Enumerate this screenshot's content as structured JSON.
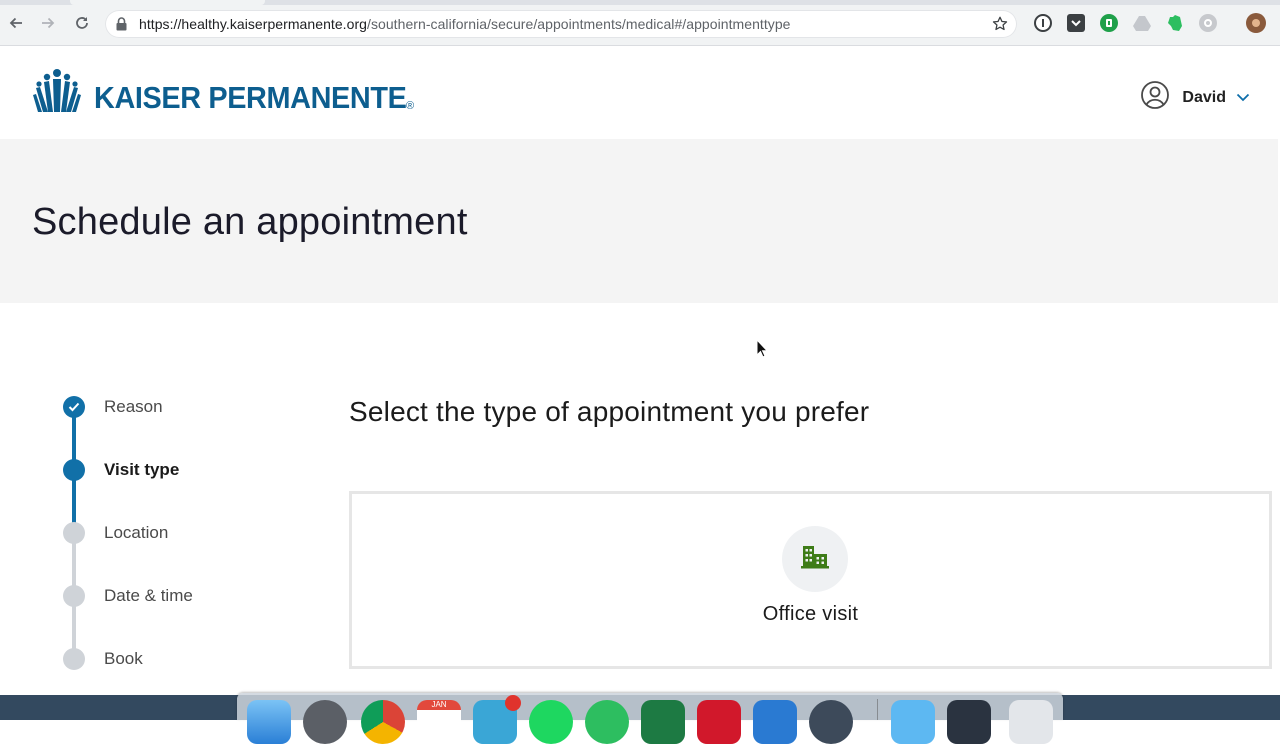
{
  "browser": {
    "url_host": "https://healthy.kaiserpermanente.org",
    "url_path": "/southern-california/secure/appointments/medical#/appointmenttype"
  },
  "header": {
    "logo_text": "KAISER PERMANENTE",
    "logo_registered": "®",
    "user_name": "David"
  },
  "page": {
    "title": "Schedule an appointment"
  },
  "stepper": {
    "steps": [
      {
        "label": "Reason",
        "state": "complete"
      },
      {
        "label": "Visit type",
        "state": "current"
      },
      {
        "label": "Location",
        "state": "upcoming"
      },
      {
        "label": "Date & time",
        "state": "upcoming"
      },
      {
        "label": "Book",
        "state": "upcoming"
      }
    ]
  },
  "main": {
    "heading": "Select the type of appointment you prefer",
    "options": [
      {
        "label": "Office visit",
        "icon": "building-icon"
      }
    ]
  },
  "dock": {
    "calendar_month": "JAN"
  },
  "colors": {
    "brand_blue": "#0d5e8f",
    "step_active": "#1170a8",
    "step_inactive": "#cfd3d8",
    "option_icon": "#3e7c17"
  }
}
